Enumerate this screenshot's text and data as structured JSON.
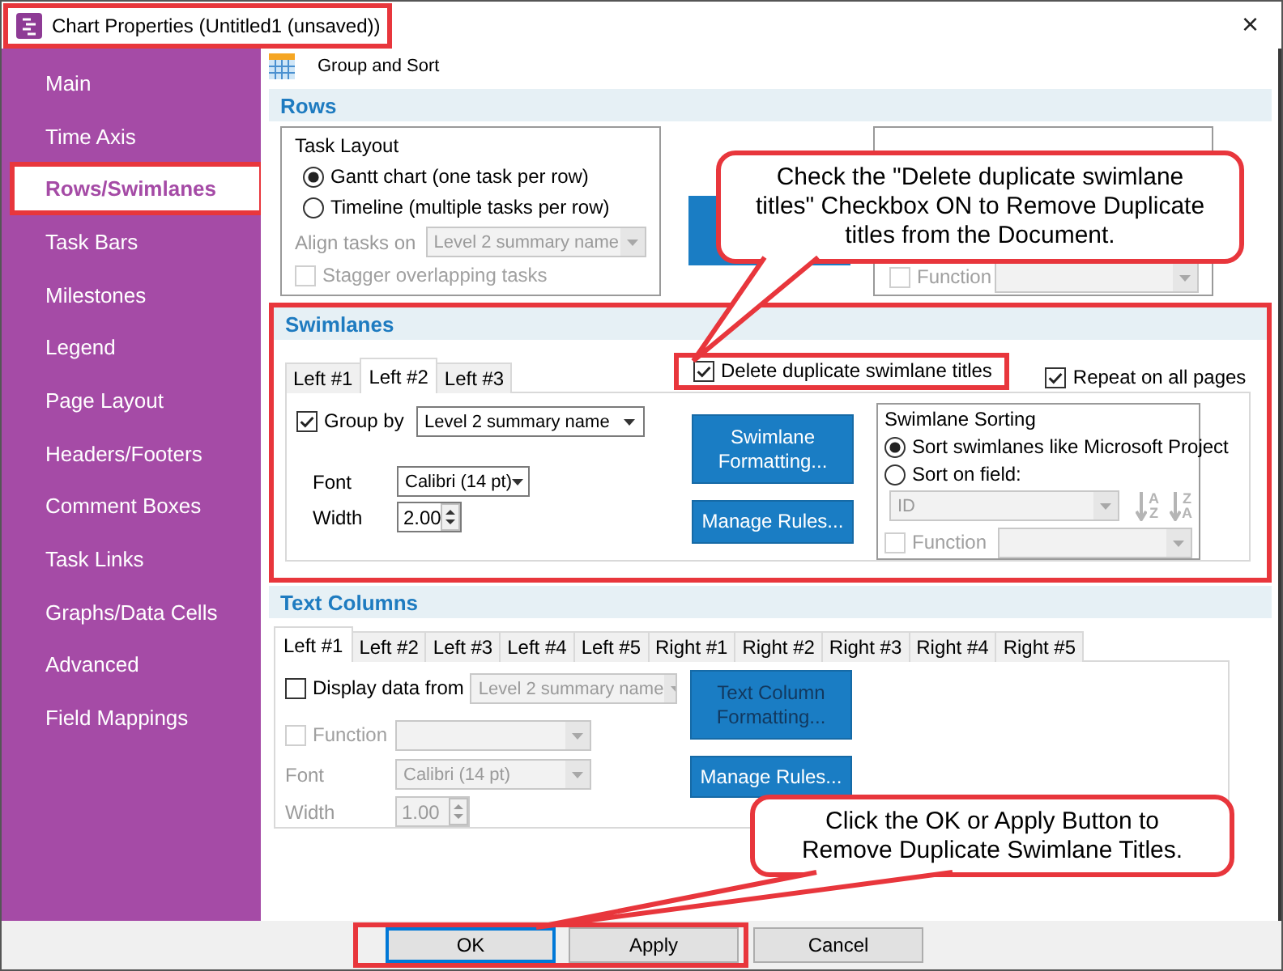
{
  "window": {
    "title": "Chart Properties (Untitled1 (unsaved))",
    "highlighted": true,
    "close": "×"
  },
  "sidebar": {
    "items": [
      {
        "label": "Main",
        "selected": false,
        "highlighted": false
      },
      {
        "label": "Time Axis",
        "selected": false,
        "highlighted": false
      },
      {
        "label": "Rows/Swimlanes",
        "selected": true,
        "highlighted": true
      },
      {
        "label": "Task Bars",
        "selected": false,
        "highlighted": false
      },
      {
        "label": "Milestones",
        "selected": false,
        "highlighted": false
      },
      {
        "label": "Legend",
        "selected": false,
        "highlighted": false
      },
      {
        "label": "Page Layout",
        "selected": false,
        "highlighted": false
      },
      {
        "label": "Headers/Footers",
        "selected": false,
        "highlighted": false
      },
      {
        "label": "Comment Boxes",
        "selected": false,
        "highlighted": false
      },
      {
        "label": "Task Links",
        "selected": false,
        "highlighted": false
      },
      {
        "label": "Graphs/Data Cells",
        "selected": false,
        "highlighted": false
      },
      {
        "label": "Advanced",
        "selected": false,
        "highlighted": false
      },
      {
        "label": "Field Mappings",
        "selected": false,
        "highlighted": false
      }
    ]
  },
  "page": {
    "title": "Group and Sort"
  },
  "rows": {
    "title": "Rows",
    "highlighted": false,
    "task_layout": {
      "title": "Task Layout",
      "options": [
        {
          "label": "Gantt chart (one task per row)",
          "selected": true
        },
        {
          "label": "Timeline (multiple tasks per row)",
          "selected": false
        }
      ],
      "align": {
        "label": "Align tasks on",
        "value": "Level 2 summary name",
        "disabled": true
      },
      "stagger": {
        "label": "Stagger overlapping tasks",
        "checked": false,
        "disabled": true
      }
    },
    "row_sorting": {
      "function": {
        "label": "Function",
        "checked": false,
        "disabled": true
      },
      "function_field": {
        "disabled": true
      }
    }
  },
  "swimlanes": {
    "title": "Swimlanes",
    "highlighted": true,
    "tabs": [
      {
        "label": "Left #1",
        "selected": false
      },
      {
        "label": "Left #2",
        "selected": true
      },
      {
        "label": "Left #3",
        "selected": false
      }
    ],
    "options": [
      {
        "label": "Delete duplicate swimlane titles",
        "checked": true,
        "highlighted": true
      },
      {
        "label": "Repeat on all pages",
        "checked": true,
        "highlighted": false
      }
    ],
    "group_by": {
      "label": "Group by",
      "checked": true
    },
    "group_field": {
      "value": "Level 2 summary name",
      "disabled": false
    },
    "font": {
      "label": "Font",
      "value": "Calibri (14 pt)",
      "disabled": false
    },
    "width": {
      "label": "Width",
      "value": "2.00",
      "disabled": false
    },
    "buttons": [
      {
        "label": "Swimlane Formatting...",
        "disabled": false
      },
      {
        "label": "Manage Rules...",
        "disabled": false
      }
    ],
    "sorting": {
      "title": "Swimlane Sorting",
      "options": [
        {
          "label": "Sort swimlanes like Microsoft Project",
          "selected": true
        },
        {
          "label": "Sort on field:",
          "selected": false
        }
      ],
      "field": {
        "value": "ID",
        "disabled": true
      },
      "sort_buttons": [
        {
          "letters": [
            "A",
            "Z"
          ],
          "disabled": true
        },
        {
          "letters": [
            "Z",
            "A"
          ],
          "disabled": true
        }
      ],
      "function": {
        "label": "Function",
        "checked": false,
        "disabled": true
      },
      "function_field": {
        "disabled": true
      }
    }
  },
  "text_columns": {
    "title": "Text Columns",
    "highlighted": false,
    "tabs": [
      {
        "label": "Left #1",
        "selected": true
      },
      {
        "label": "Left #2",
        "selected": false
      },
      {
        "label": "Left #3",
        "selected": false
      },
      {
        "label": "Left #4",
        "selected": false
      },
      {
        "label": "Left #5",
        "selected": false
      },
      {
        "label": "Right #1",
        "selected": false
      },
      {
        "label": "Right #2",
        "selected": false
      },
      {
        "label": "Right #3",
        "selected": false
      },
      {
        "label": "Right #4",
        "selected": false
      },
      {
        "label": "Right #5",
        "selected": false
      }
    ],
    "display": {
      "label": "Display data from",
      "checked": false,
      "disabled": false
    },
    "display_field": {
      "value": "Level 2 summary name",
      "disabled": true
    },
    "function": {
      "label": "Function",
      "checked": false,
      "disabled": true
    },
    "function_field": {
      "disabled": true
    },
    "font": {
      "label": "Font",
      "value": "Calibri (14 pt)",
      "disabled": true
    },
    "width": {
      "label": "Width",
      "value": "1.00",
      "disabled": true
    },
    "buttons": [
      {
        "label": "Text Column Formatting...",
        "disabled": true
      },
      {
        "label": "Manage Rules...",
        "disabled": false
      }
    ]
  },
  "footer": {
    "buttons": [
      {
        "label": "OK",
        "default": true,
        "highlighted": true
      },
      {
        "label": "Apply",
        "default": false,
        "highlighted": true
      },
      {
        "label": "Cancel",
        "default": false,
        "highlighted": false
      }
    ]
  },
  "callouts": [
    {
      "text": "Check the \"Delete duplicate swimlane titles\" Checkbox ON to Remove Duplicate titles from the Document."
    },
    {
      "text": "Click the OK or Apply Button to Remove Duplicate Swimlane Titles."
    }
  ]
}
